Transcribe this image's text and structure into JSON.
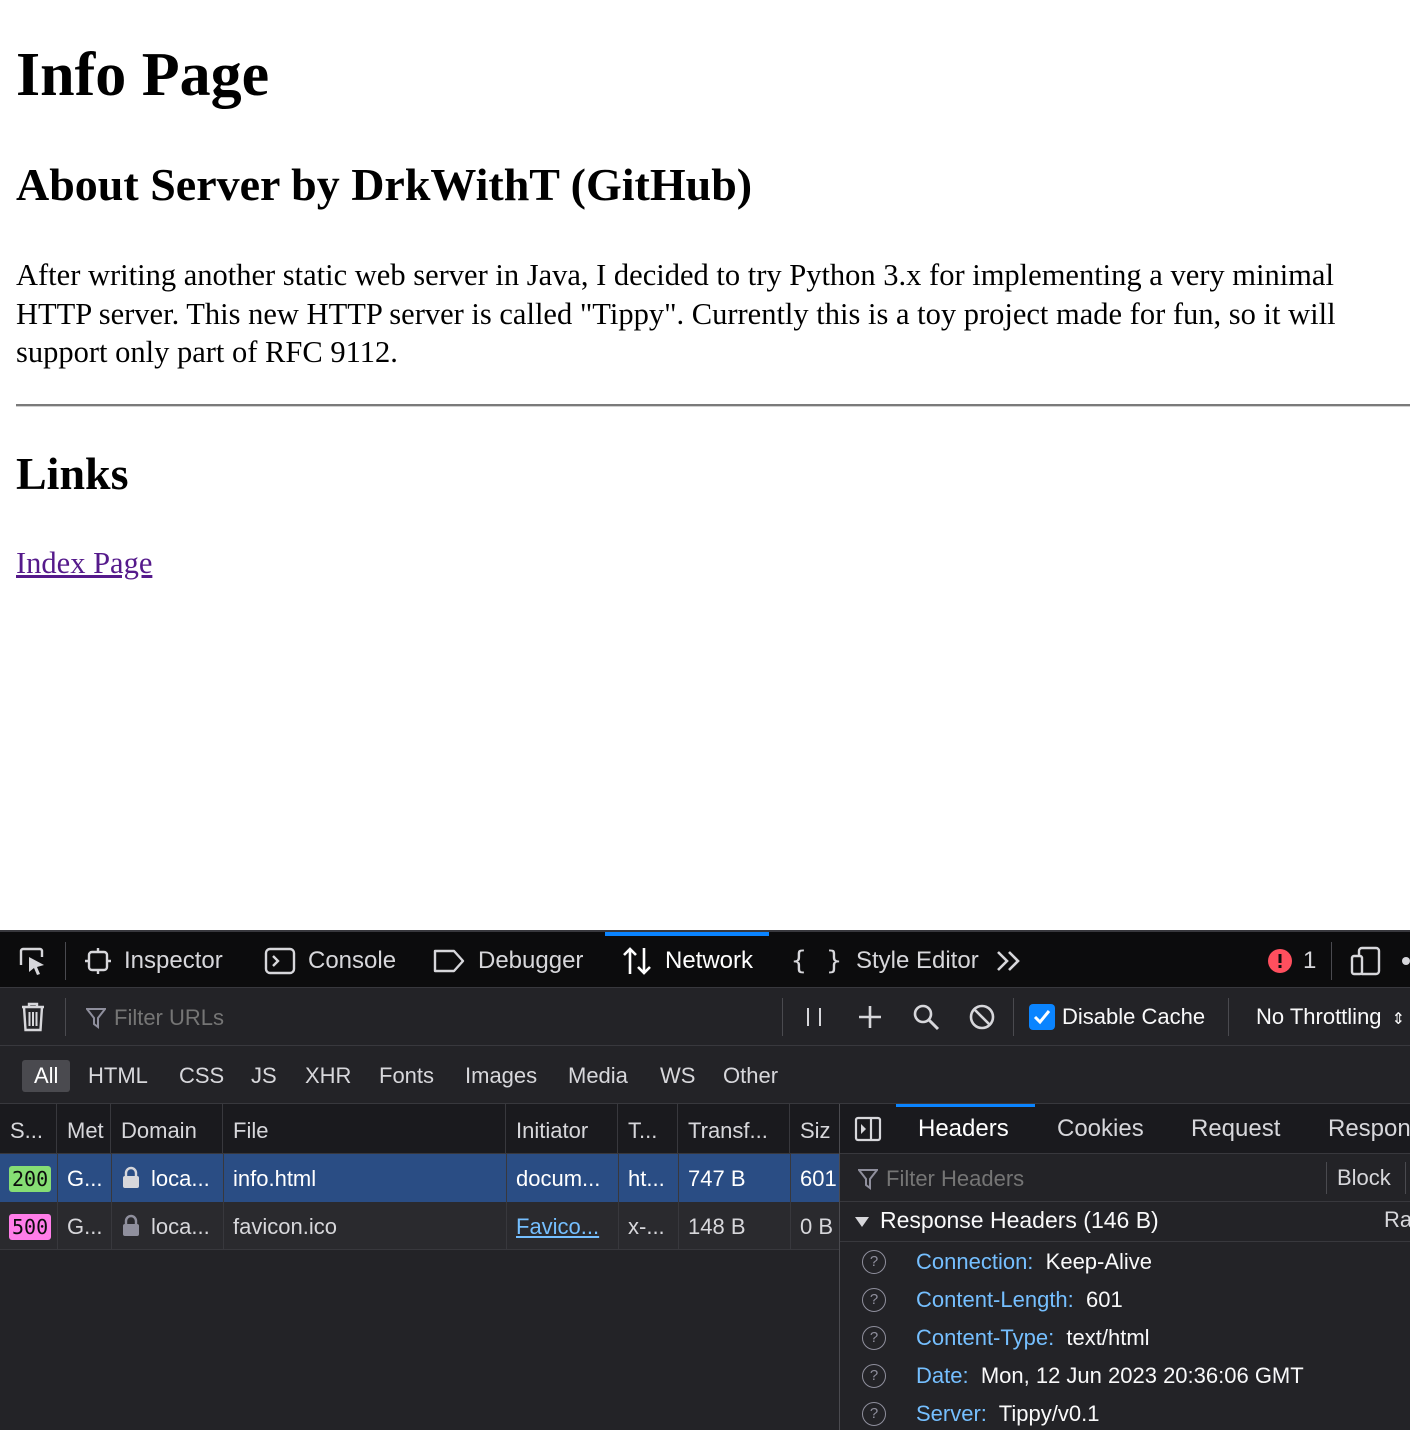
{
  "page": {
    "title": "Info Page",
    "about_heading": "About Server by DrkWithT (GitHub)",
    "description": "After writing another static web server in Java, I decided to try Python 3.x for implementing a very minimal HTTP server. This new HTTP server is called \"Tippy\". Currently this is a toy project made for fun, so it will support only part of RFC 9112.",
    "links_heading": "Links",
    "index_link": "Index Page"
  },
  "devtools": {
    "tools": [
      "Inspector",
      "Console",
      "Debugger",
      "Network",
      "Style Editor"
    ],
    "active_tool": "Network",
    "error_count": "1",
    "filter_placeholder": "Filter URLs",
    "disable_cache_label": "Disable Cache",
    "disable_cache_checked": true,
    "throttling": "No Throttling",
    "type_filters": [
      "All",
      "HTML",
      "CSS",
      "JS",
      "XHR",
      "Fonts",
      "Images",
      "Media",
      "WS",
      "Other"
    ],
    "selected_type": "All",
    "columns": [
      "S...",
      "Met",
      "Domain",
      "File",
      "Initiator",
      "T...",
      "Transf...",
      "Siz"
    ],
    "requests": [
      {
        "status": "200",
        "method": "G...",
        "domain": "loca...",
        "file": "info.html",
        "initiator": "docum...",
        "type": "ht...",
        "transferred": "747 B",
        "size": "601"
      },
      {
        "status": "500",
        "method": "G...",
        "domain": "loca...",
        "file": "favicon.ico",
        "initiator": "Favico...",
        "type": "x-...",
        "transferred": "148 B",
        "size": "0 B"
      }
    ],
    "side_tabs": [
      "Headers",
      "Cookies",
      "Request",
      "Respon"
    ],
    "active_side_tab": "Headers",
    "header_filter_placeholder": "Filter Headers",
    "block_label": "Block",
    "response_headers_label": "Response Headers (146 B)",
    "raw_label": "Ra",
    "response_headers": [
      {
        "name": "Connection:",
        "value": "Keep-Alive"
      },
      {
        "name": "Content-Length:",
        "value": "601"
      },
      {
        "name": "Content-Type:",
        "value": "text/html"
      },
      {
        "name": "Date:",
        "value": "Mon, 12 Jun 2023 20:36:06 GMT"
      },
      {
        "name": "Server:",
        "value": "Tippy/v0.1"
      }
    ],
    "colors": {
      "accent": "#0a84ff",
      "status_200": "#86de74",
      "status_500": "#ff7de9",
      "selected_row": "#2a4d84",
      "error_badge": "#ff4f5e"
    }
  }
}
